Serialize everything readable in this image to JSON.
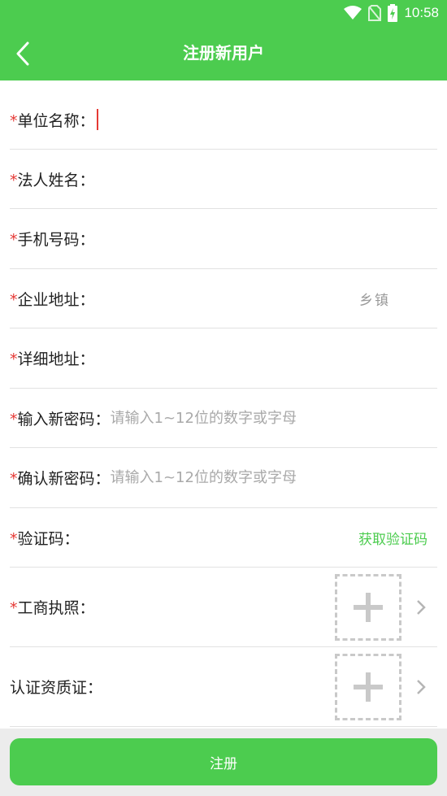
{
  "status_bar": {
    "time": "10:58"
  },
  "nav": {
    "title": "注册新用户"
  },
  "form": {
    "required_mark": "*",
    "unit_name": {
      "label": "单位名称："
    },
    "legal_person": {
      "label": "法人姓名："
    },
    "phone": {
      "label": "手机号码："
    },
    "company_address": {
      "label": "企业地址：",
      "town": "乡镇"
    },
    "detail_address": {
      "label": "详细地址："
    },
    "new_password": {
      "label": "输入新密码：",
      "placeholder": "请输入1~12位的数字或字母"
    },
    "confirm_password": {
      "label": "确认新密码：",
      "placeholder": "请输入1~12位的数字或字母"
    },
    "verify_code": {
      "label": "验证码：",
      "action": "获取验证码"
    },
    "business_license": {
      "label": "工商执照："
    },
    "certificate": {
      "label": "认证资质证："
    }
  },
  "footer": {
    "register_label": "注册"
  },
  "colors": {
    "primary": "#4ccc4f",
    "required": "#e53935",
    "placeholder": "#a9a9a9"
  }
}
